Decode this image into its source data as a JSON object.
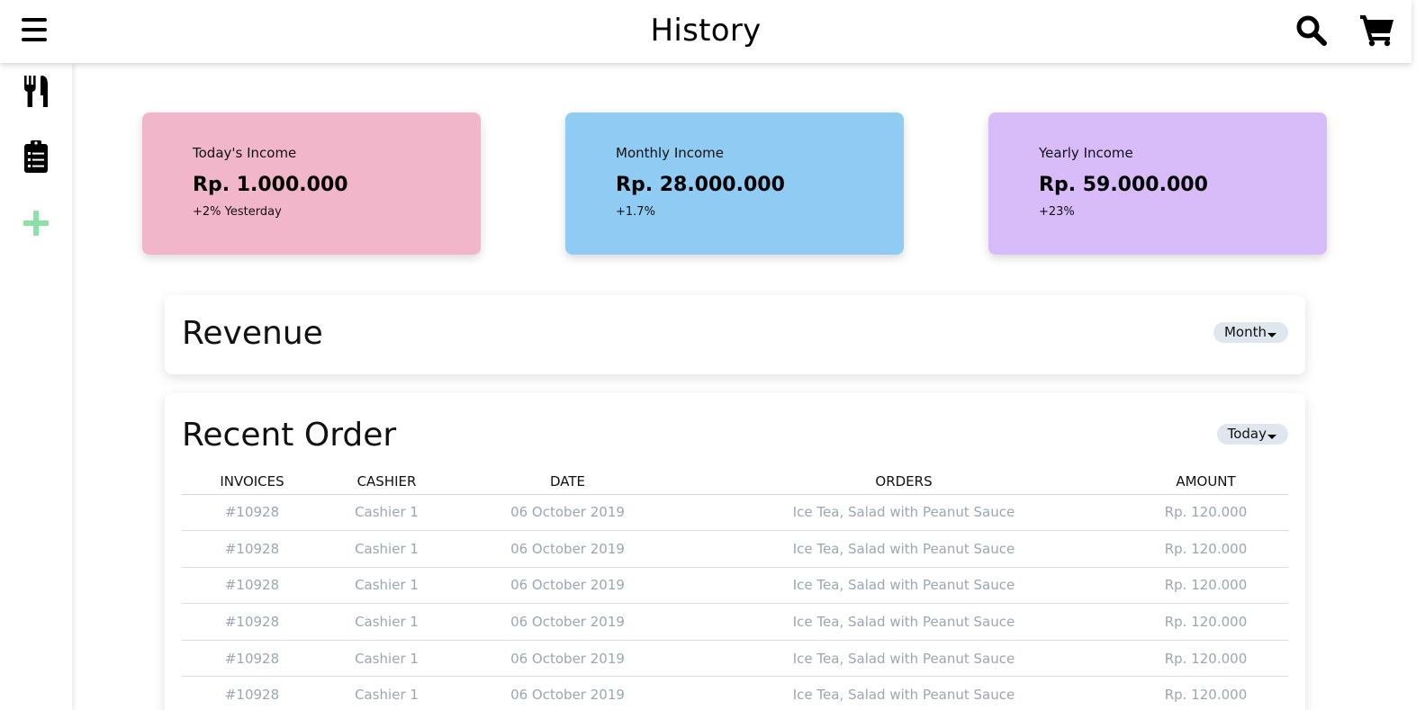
{
  "header": {
    "title": "History"
  },
  "icons": {
    "menu": "hamburger-icon",
    "search": "search-icon",
    "cart": "cart-icon",
    "sidebar": [
      "fork-knife-icon",
      "clipboard-list-icon",
      "plus-icon"
    ]
  },
  "colors": {
    "today_card": "#f2b6cb",
    "monthly_card": "#8fcbf2",
    "yearly_card": "#d7bcf9",
    "plus_icon": "#8de0a8",
    "row_text": "#9ca6b2"
  },
  "cards": [
    {
      "label": "Today's Income",
      "value": "Rp. 1.000.000",
      "change": "+2% Yesterday"
    },
    {
      "label": "Monthly Income",
      "value": "Rp. 28.000.000",
      "change": "+1.7%"
    },
    {
      "label": "Yearly Income",
      "value": "Rp. 59.000.000",
      "change": "+23%"
    }
  ],
  "revenue": {
    "title": "Revenue",
    "filter": "Month"
  },
  "recent_order": {
    "title": "Recent Order",
    "filter": "Today",
    "columns": [
      "INVOICES",
      "CASHIER",
      "DATE",
      "ORDERS",
      "AMOUNT"
    ],
    "rows": [
      [
        "#10928",
        "Cashier 1",
        "06 October 2019",
        "Ice Tea, Salad with Peanut Sauce",
        "Rp. 120.000"
      ],
      [
        "#10928",
        "Cashier 1",
        "06 October 2019",
        "Ice Tea, Salad with Peanut Sauce",
        "Rp. 120.000"
      ],
      [
        "#10928",
        "Cashier 1",
        "06 October 2019",
        "Ice Tea, Salad with Peanut Sauce",
        "Rp. 120.000"
      ],
      [
        "#10928",
        "Cashier 1",
        "06 October 2019",
        "Ice Tea, Salad with Peanut Sauce",
        "Rp. 120.000"
      ],
      [
        "#10928",
        "Cashier 1",
        "06 October 2019",
        "Ice Tea, Salad with Peanut Sauce",
        "Rp. 120.000"
      ],
      [
        "#10928",
        "Cashier 1",
        "06 October 2019",
        "Ice Tea, Salad with Peanut Sauce",
        "Rp. 120.000"
      ]
    ]
  }
}
